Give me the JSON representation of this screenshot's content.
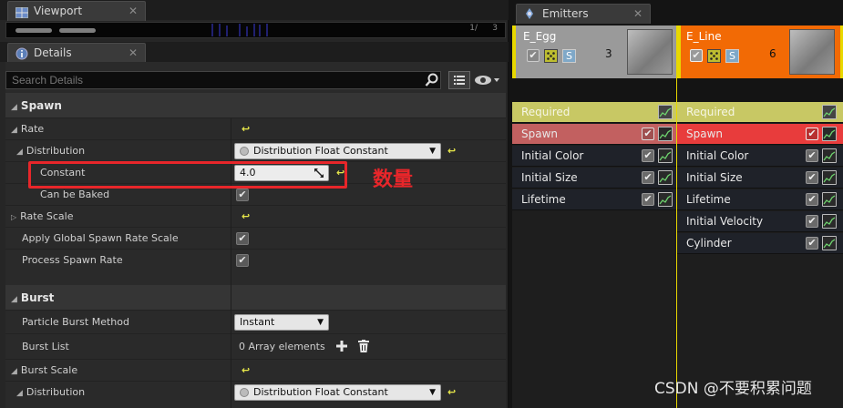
{
  "viewport_tab": {
    "title": "Viewport",
    "close": "✕",
    "counter_left": "1/",
    "counter_right": "3"
  },
  "details_tab": {
    "title": "Details",
    "close": "✕"
  },
  "search": {
    "placeholder": "Search Details"
  },
  "sections": {
    "spawn": "Spawn",
    "rate": "Rate",
    "distribution": "Distribution",
    "distribution_value": "Distribution Float Constant",
    "constant": "Constant",
    "constant_value": "4.0",
    "can_be_baked": "Can be Baked",
    "rate_scale": "Rate Scale",
    "apply_global": "Apply Global Spawn Rate Scale",
    "process_spawn_rate": "Process Spawn Rate",
    "burst": "Burst",
    "particle_burst_method": "Particle Burst Method",
    "burst_method_value": "Instant",
    "burst_list": "Burst List",
    "burst_list_value": "0 Array elements",
    "burst_scale": "Burst Scale",
    "distribution2": "Distribution",
    "distribution2_value": "Distribution Float Constant"
  },
  "annotation": "数量",
  "emitters_tab": {
    "title": "Emitters",
    "close": "✕"
  },
  "emitters": [
    {
      "name": "E_Egg",
      "count": "3",
      "modules": [
        "Required",
        "Spawn",
        "Initial Color",
        "Initial Size",
        "Lifetime"
      ]
    },
    {
      "name": "E_Line",
      "count": "6",
      "modules": [
        "Required",
        "Spawn",
        "Initial Color",
        "Initial Size",
        "Lifetime",
        "Initial Velocity",
        "Cylinder"
      ]
    }
  ],
  "emitter_badge": "S",
  "colors": {
    "accent_orange": "#f26a05",
    "required_yellow": "#c8c864",
    "spawn_red": "#e83c3c",
    "spawn_muted": "#c26060",
    "annotation_red": "#e8262a"
  },
  "watermark": "CSDN @不要积累问题"
}
